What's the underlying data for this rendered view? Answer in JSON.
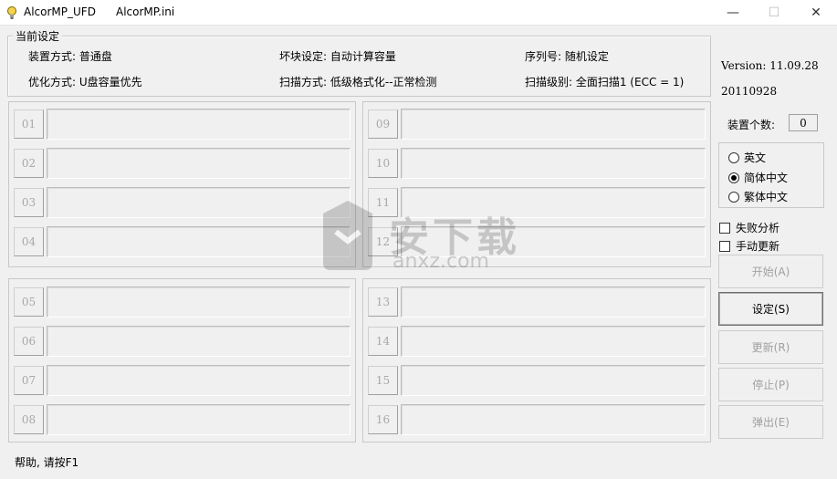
{
  "window": {
    "app_name": "AlcorMP_UFD",
    "ini_file": "AlcorMP.ini",
    "minimize": "—",
    "maximize": "☐",
    "close": "✕"
  },
  "settings": {
    "title": "当前设定",
    "device_mode": "装置方式: 普通盘",
    "bad_block": "坏块设定: 自动计算容量",
    "serial": "序列号: 随机设定",
    "optimize": "优化方式: U盘容量优先",
    "scan_mode": "扫描方式: 低级格式化--正常检测",
    "scan_level": "扫描级别: 全面扫描1 (ECC = 1)"
  },
  "slots": [
    "01",
    "02",
    "03",
    "04",
    "05",
    "06",
    "07",
    "08",
    "09",
    "10",
    "11",
    "12",
    "13",
    "14",
    "15",
    "16"
  ],
  "side": {
    "version": "Version: 11.09.28",
    "date": "20110928",
    "device_count_label": "装置个数:",
    "device_count": "0",
    "languages": [
      {
        "label": "英文",
        "selected": false
      },
      {
        "label": "简体中文",
        "selected": true
      },
      {
        "label": "繁体中文",
        "selected": false
      }
    ],
    "fail_analysis": "失败分析",
    "manual_update": "手动更新"
  },
  "buttons": {
    "start": "开始(A)",
    "settings": "设定(S)",
    "update": "更新(R)",
    "stop": "停止(P)",
    "eject": "弹出(E)"
  },
  "status": "帮助, 请按F1",
  "watermark": {
    "main": "安下载",
    "sub": "anxz.com"
  }
}
